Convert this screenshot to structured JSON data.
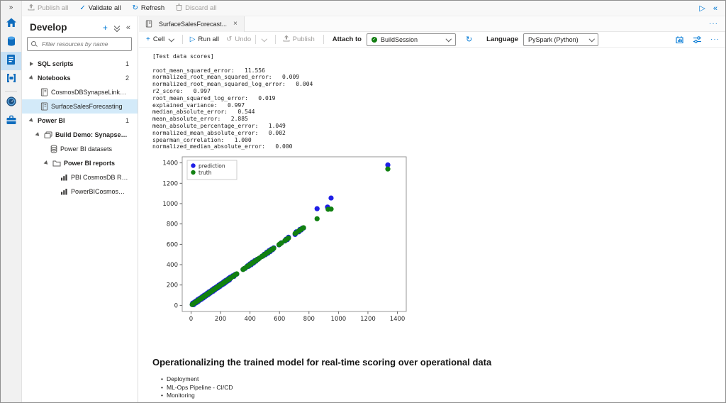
{
  "glyphs": {
    "double_chevron_right": "»",
    "collapse_left": "«",
    "plus": "+",
    "close": "×",
    "ellipsis": "···",
    "play": "▷",
    "undo": "↺",
    "refresh": "↻",
    "check": "✓"
  },
  "app_toolbar": {
    "publish_all": "Publish all",
    "validate_all": "Validate all",
    "refresh": "Refresh",
    "discard_all": "Discard all"
  },
  "develop_panel": {
    "title": "Develop",
    "filter_placeholder": "Filter resources by name",
    "tree": [
      {
        "label": "SQL scripts",
        "count": "1",
        "level": 0,
        "group": true,
        "expander": "closed",
        "icon": null,
        "selected": false
      },
      {
        "label": "Notebooks",
        "count": "2",
        "level": 0,
        "group": true,
        "expander": "open",
        "icon": null,
        "selected": false
      },
      {
        "label": "CosmosDBSynapseLink_Reta...",
        "count": "",
        "level": 1,
        "group": false,
        "expander": null,
        "icon": "notebook",
        "selected": false
      },
      {
        "label": "SurfaceSalesForecasting",
        "count": "",
        "level": 1,
        "group": false,
        "expander": null,
        "icon": "notebook",
        "selected": true
      },
      {
        "label": "Power BI",
        "count": "1",
        "level": 0,
        "group": true,
        "expander": "open",
        "icon": null,
        "selected": false
      },
      {
        "label": "Build Demo: Synapse Link f...",
        "count": "",
        "level": 1,
        "group": true,
        "expander": "open",
        "icon": "workspace",
        "selected": false
      },
      {
        "label": "Power BI datasets",
        "count": "",
        "level": 2,
        "group": false,
        "expander": null,
        "icon": "datasets",
        "selected": false
      },
      {
        "label": "Power BI reports",
        "count": "",
        "level": 2,
        "group": true,
        "expander": "open",
        "icon": "folder",
        "selected": false
      },
      {
        "label": "PBI CosmosDB Retail ...",
        "count": "",
        "level": 3,
        "group": false,
        "expander": null,
        "icon": "report",
        "selected": false
      },
      {
        "label": "PowerBICosmosDB B...",
        "count": "",
        "level": 3,
        "group": false,
        "expander": null,
        "icon": "report",
        "selected": false
      }
    ]
  },
  "tab_bar": {
    "active_tab": "SurfaceSalesForecast..."
  },
  "notebook_toolbar": {
    "cell": "Cell",
    "run_all": "Run all",
    "undo": "Undo",
    "publish": "Publish",
    "attach_to_label": "Attach to",
    "session_name": "BuildSession",
    "language_label": "Language",
    "language_value": "PySpark (Python)"
  },
  "output_text": "[Test data scores]\n\nroot_mean_squared_error:   11.556\nnormalized_root_mean_squared_error:   0.009\nnormalized_root_mean_squared_log_error:   0.004\nr2_score:   0.997\nroot_mean_squared_log_error:   0.019\nexplained_variance:   0.997\nmedian_absolute_error:   0.544\nmean_absolute_error:   2.885\nmean_absolute_percentage_error:   1.049\nnormalized_mean_absolute_error:   0.002\nspearman_correlation:   1.000\nnormalized_median_absolute_error:   0.000",
  "markdown": {
    "heading": "Operationalizing the trained model for real-time scoring over operational data",
    "bullets": [
      "Deployment",
      "ML-Ops Pipeline - CI/CD",
      "Monitoring"
    ]
  },
  "chart_data": {
    "type": "scatter",
    "title": "",
    "xlabel": "",
    "ylabel": "",
    "legend": [
      "prediction",
      "truth"
    ],
    "legend_position": "upper-left",
    "series": [
      {
        "name": "prediction",
        "color": "#1f1fe6"
      },
      {
        "name": "truth",
        "color": "#118011"
      }
    ],
    "x_ticks": [
      0,
      200,
      400,
      600,
      800,
      1000,
      1200,
      1400
    ],
    "y_ticks": [
      0,
      200,
      400,
      600,
      800,
      1000,
      1200,
      1400
    ],
    "xlim": [
      -60,
      1460
    ],
    "ylim": [
      -60,
      1460
    ],
    "marker_radius": 3.6,
    "diagonal_dense": {
      "from": 8,
      "to": 270,
      "step": 3
    },
    "diagonal_sparse": [
      283,
      291,
      300,
      310,
      353,
      360,
      368,
      383,
      391,
      400,
      408,
      416,
      424,
      432,
      440,
      448,
      456,
      464,
      480,
      488,
      497,
      505,
      513,
      521,
      529,
      537,
      545,
      553,
      561,
      597,
      605,
      613,
      637,
      645,
      653,
      661,
      706,
      714,
      731,
      739,
      747,
      755,
      763
    ],
    "prediction_jitter": 11,
    "outliers": {
      "prediction": [
        [
          855,
          950
        ],
        [
          926,
          966
        ],
        [
          950,
          1055
        ],
        [
          1335,
          1380
        ]
      ],
      "truth": [
        [
          855,
          851
        ],
        [
          930,
          944
        ],
        [
          950,
          946
        ],
        [
          1335,
          1340
        ]
      ]
    }
  }
}
